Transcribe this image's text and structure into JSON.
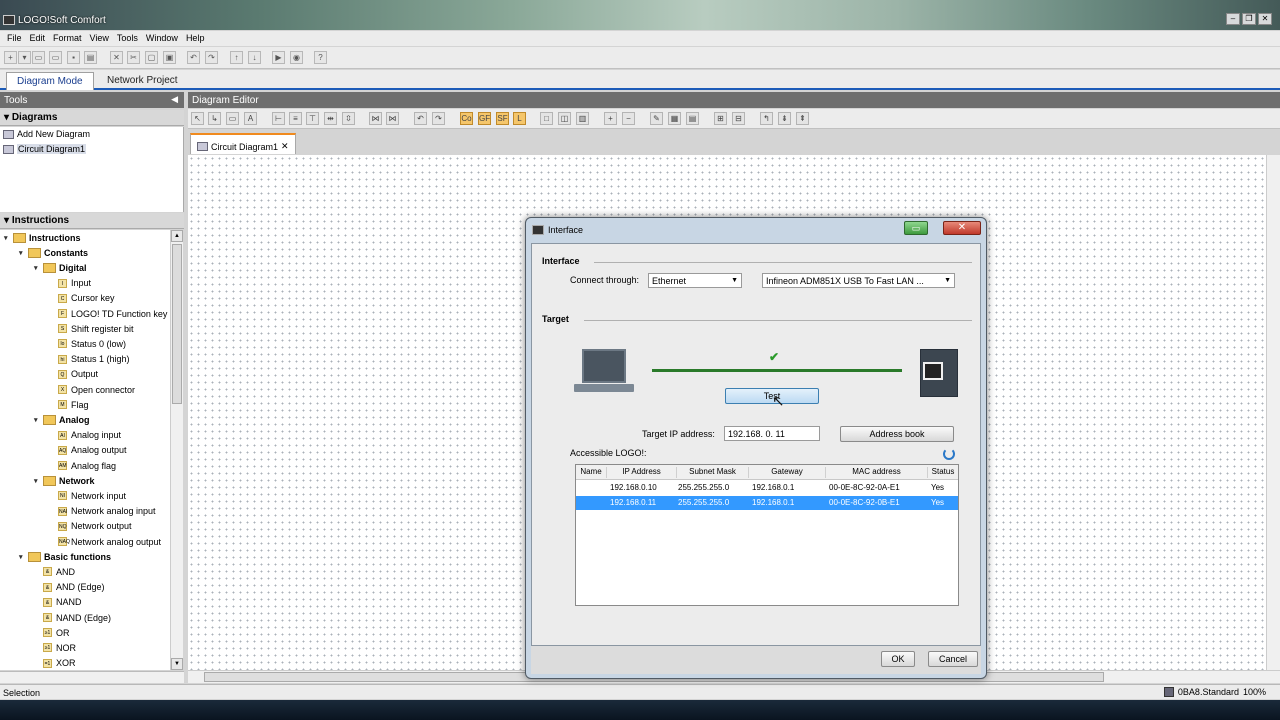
{
  "window": {
    "title": "LOGO!Soft Comfort"
  },
  "menu": [
    "File",
    "Edit",
    "Format",
    "View",
    "Tools",
    "Window",
    "Help"
  ],
  "modes": {
    "active": "Diagram Mode",
    "inactive": "Network Project"
  },
  "tools_panel": {
    "title": "Tools",
    "diagrams_title": "Diagrams",
    "diagrams": [
      "Add New Diagram",
      "Circuit Diagram1"
    ],
    "instructions_title": "Instructions",
    "tree": [
      {
        "label": "Instructions",
        "level": 0,
        "type": "folder",
        "bold": true
      },
      {
        "label": "Constants",
        "level": 1,
        "type": "folder",
        "bold": true
      },
      {
        "label": "Digital",
        "level": 2,
        "type": "folder",
        "bold": true
      },
      {
        "label": "Input",
        "level": 3,
        "type": "leaf",
        "code": "I"
      },
      {
        "label": "Cursor key",
        "level": 3,
        "type": "leaf",
        "code": "C"
      },
      {
        "label": "LOGO! TD Function key",
        "level": 3,
        "type": "leaf",
        "code": "F"
      },
      {
        "label": "Shift register bit",
        "level": 3,
        "type": "leaf",
        "code": "S"
      },
      {
        "label": "Status 0 (low)",
        "level": 3,
        "type": "leaf",
        "code": "lo"
      },
      {
        "label": "Status 1 (high)",
        "level": 3,
        "type": "leaf",
        "code": "hi"
      },
      {
        "label": "Output",
        "level": 3,
        "type": "leaf",
        "code": "Q"
      },
      {
        "label": "Open connector",
        "level": 3,
        "type": "leaf",
        "code": "X"
      },
      {
        "label": "Flag",
        "level": 3,
        "type": "leaf",
        "code": "M"
      },
      {
        "label": "Analog",
        "level": 2,
        "type": "folder",
        "bold": true
      },
      {
        "label": "Analog input",
        "level": 3,
        "type": "leaf",
        "code": "AI"
      },
      {
        "label": "Analog output",
        "level": 3,
        "type": "leaf",
        "code": "AQ"
      },
      {
        "label": "Analog flag",
        "level": 3,
        "type": "leaf",
        "code": "AM"
      },
      {
        "label": "Network",
        "level": 2,
        "type": "folder",
        "bold": true
      },
      {
        "label": "Network input",
        "level": 3,
        "type": "leaf",
        "code": "NI"
      },
      {
        "label": "Network analog input",
        "level": 3,
        "type": "leaf",
        "code": "NAI"
      },
      {
        "label": "Network output",
        "level": 3,
        "type": "leaf",
        "code": "NQ"
      },
      {
        "label": "Network analog output",
        "level": 3,
        "type": "leaf",
        "code": "NAQ"
      },
      {
        "label": "Basic functions",
        "level": 1,
        "type": "folder",
        "bold": true
      },
      {
        "label": "AND",
        "level": 2,
        "type": "leaf",
        "code": "&"
      },
      {
        "label": "AND (Edge)",
        "level": 2,
        "type": "leaf",
        "code": "&"
      },
      {
        "label": "NAND",
        "level": 2,
        "type": "leaf",
        "code": "&"
      },
      {
        "label": "NAND (Edge)",
        "level": 2,
        "type": "leaf",
        "code": "&"
      },
      {
        "label": "OR",
        "level": 2,
        "type": "leaf",
        "code": "≥1"
      },
      {
        "label": "NOR",
        "level": 2,
        "type": "leaf",
        "code": "≥1"
      },
      {
        "label": "XOR",
        "level": 2,
        "type": "leaf",
        "code": "=1"
      }
    ]
  },
  "editor": {
    "title": "Diagram Editor",
    "tab": "Circuit Diagram1"
  },
  "status": {
    "left": "Selection",
    "device": "0BA8.Standard",
    "zoom": "100%"
  },
  "dialog": {
    "title": "Interface",
    "interface_label": "Interface",
    "connect_label": "Connect through:",
    "connect_value": "Ethernet",
    "adapter_value": "Infineon ADM851X USB To Fast LAN ...",
    "target_label": "Target",
    "test_button": "Test",
    "target_ip_label": "Target IP address:",
    "target_ip_value": "192.168.  0. 11",
    "address_book_button": "Address book",
    "accessible_label": "Accessible LOGO!:",
    "columns": [
      "Name",
      "IP Address",
      "Subnet Mask",
      "Gateway",
      "MAC address",
      "Status"
    ],
    "rows": [
      {
        "name": "",
        "ip": "192.168.0.10",
        "mask": "255.255.255.0",
        "gateway": "192.168.0.1",
        "mac": "00-0E-8C-92-0A-E1",
        "status": "Yes"
      },
      {
        "name": "",
        "ip": "192.168.0.11",
        "mask": "255.255.255.0",
        "gateway": "192.168.0.1",
        "mac": "00-0E-8C-92-0B-E1",
        "status": "Yes"
      }
    ],
    "ok_button": "OK",
    "cancel_button": "Cancel"
  }
}
